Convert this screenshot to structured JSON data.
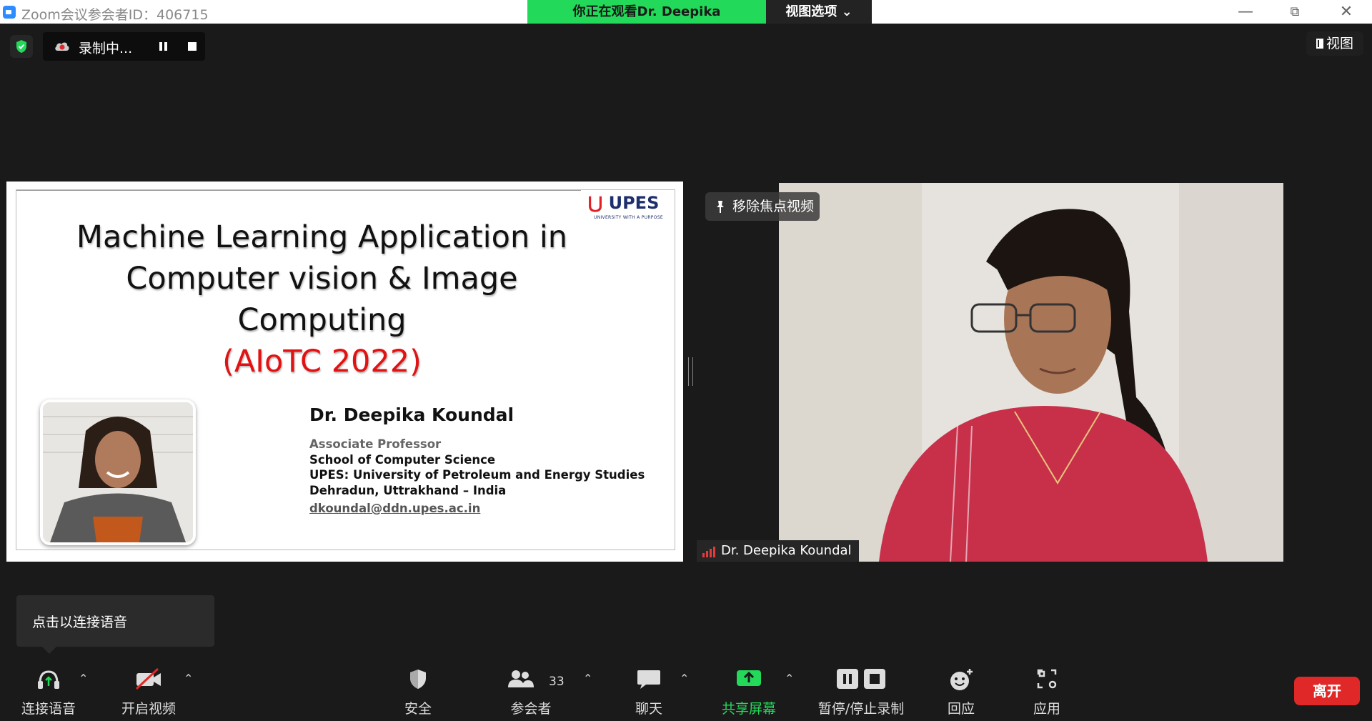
{
  "window": {
    "title": "Zoom会议参会者ID：406715",
    "minimize": "—",
    "restore": "⧉",
    "close": "✕"
  },
  "banner": {
    "viewing": "你正在观看Dr. Deepika  Koundal的屏幕",
    "view_options": "视图选项 ⌄"
  },
  "recording": {
    "label": "录制中..."
  },
  "view_button": {
    "label": "视图"
  },
  "slide": {
    "title_line1": "Machine Learning Application in",
    "title_line2": "Computer vision & Image",
    "title_line3": "Computing",
    "title_line4": "(AIoTC 2022)",
    "logo_text": "UPES",
    "logo_tagline": "UNIVERSITY WITH A PURPOSE",
    "speaker_name": "Dr. Deepika Koundal",
    "role": "Associate Professor",
    "school": "School of Computer Science",
    "university": "UPES: University of Petroleum and Energy Studies",
    "location": "Dehradun, Uttrakhand – India",
    "email": "dkoundal@ddn.upes.ac.in"
  },
  "video": {
    "unpin_label": "移除焦点视频",
    "participant_name": "Dr. Deepika Koundal"
  },
  "tooltip": {
    "text": "点击以连接语音"
  },
  "toolbar": {
    "audio": "连接语音",
    "video": "开启视频",
    "security": "安全",
    "participants": "参会者",
    "participants_count": "33",
    "chat": "聊天",
    "share": "共享屏幕",
    "record": "暂停/停止录制",
    "reactions": "回应",
    "apps": "应用",
    "leave": "离开"
  },
  "colors": {
    "accent_green": "#23d959",
    "leave_red": "#e02828",
    "background": "#1a1a1a"
  }
}
